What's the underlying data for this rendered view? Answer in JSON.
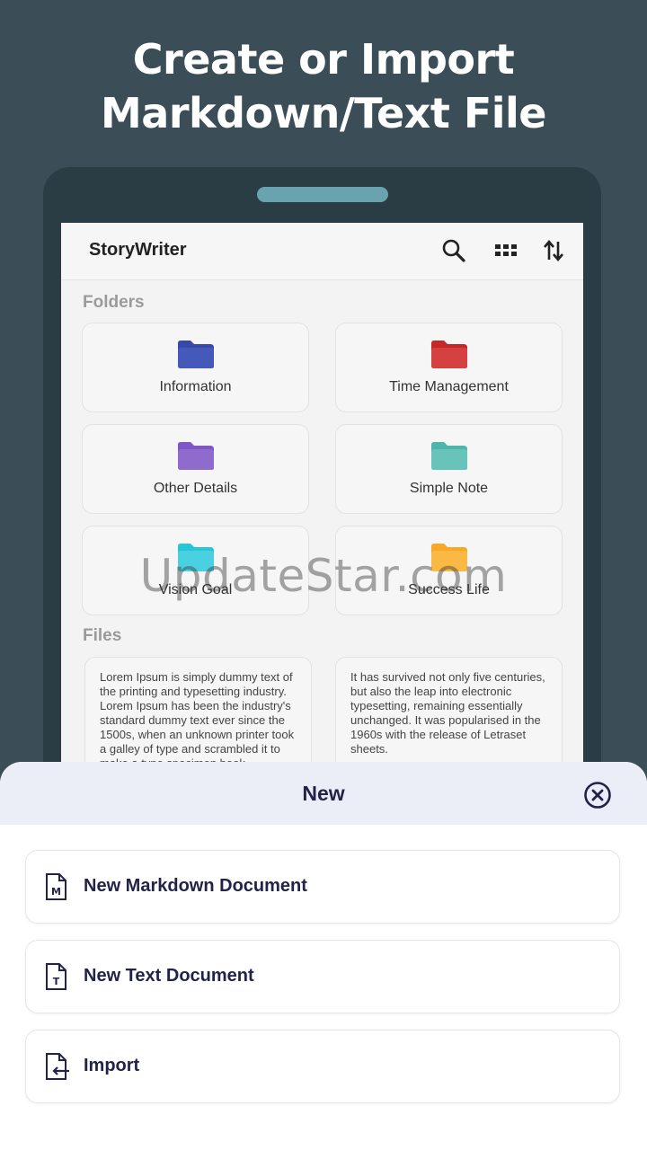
{
  "headline": {
    "line1": "Create or Import",
    "line2": "Markdown/Text File"
  },
  "app": {
    "title": "StoryWriter",
    "toolbar_icons": [
      "search-icon",
      "grid-view-icon",
      "sort-icon"
    ]
  },
  "folders": {
    "section_title": "Folders",
    "items": [
      {
        "name": "Information",
        "color": "#3949ab"
      },
      {
        "name": "Time Management",
        "color": "#c62828"
      },
      {
        "name": "Other Details",
        "color": "#7e57c2"
      },
      {
        "name": "Simple Note",
        "color": "#4db6ac"
      },
      {
        "name": "Vision Goal",
        "color": "#26c6da"
      },
      {
        "name": "Success Life",
        "color": "#f9a825"
      }
    ]
  },
  "files": {
    "section_title": "Files",
    "items": [
      {
        "text": "Lorem Ipsum is simply dummy text of the printing and typesetting industry. Lorem Ipsum has been the industry's standard dummy text ever since the 1500s, when an unknown printer took a galley of type and scrambled it to make a type specimen book."
      },
      {
        "text": "It has survived not only five centuries, but also the leap into electronic typesetting, remaining essentially unchanged. It was popularised in the 1960s with the release of Letraset sheets."
      }
    ]
  },
  "watermark": "UpdateStar.com",
  "sheet": {
    "title": "New",
    "close_icon": "close-circle-icon",
    "options": [
      {
        "label": "New Markdown Document",
        "icon": "markdown-file-icon"
      },
      {
        "label": "New Text Document",
        "icon": "text-file-icon"
      },
      {
        "label": "Import",
        "icon": "import-file-icon"
      }
    ]
  },
  "colors": {
    "background": "#3b4e57",
    "device": "#2a3d44",
    "accent_text": "#23234a",
    "sheet_header": "#ebeef7"
  }
}
